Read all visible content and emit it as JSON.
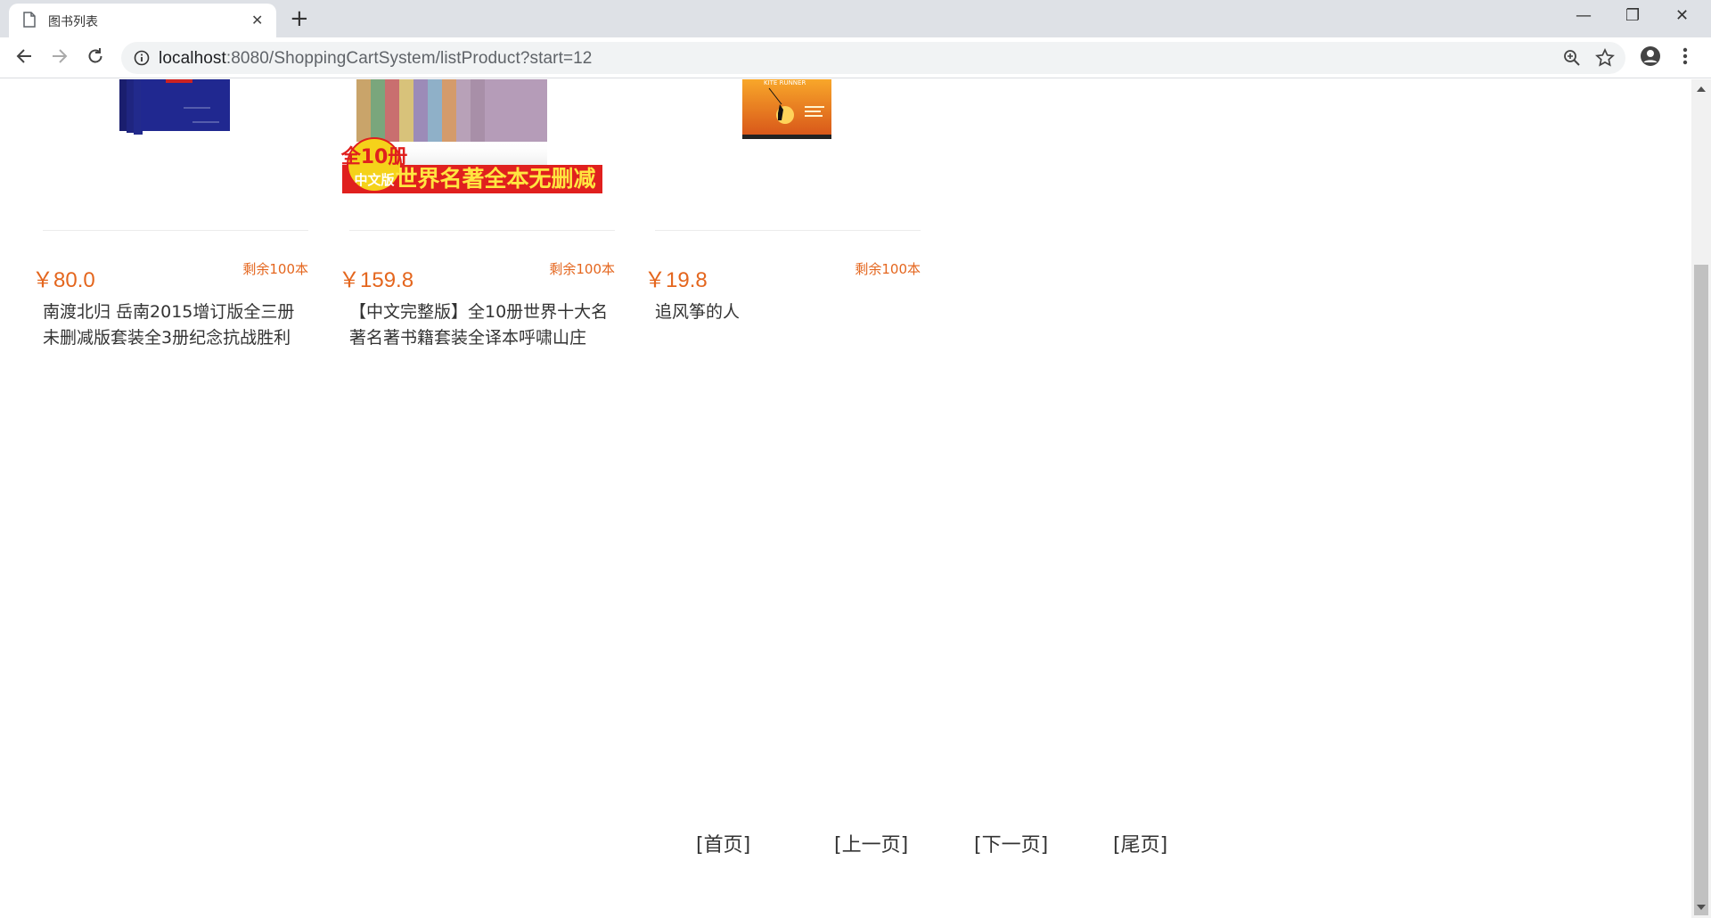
{
  "browser": {
    "tab_title": "图书列表",
    "new_tab_symbol": "+",
    "url_host": "localhost",
    "url_rest": ":8080/ShoppingCartSystem/listProduct?start=12",
    "window_controls": {
      "minimize": "—",
      "restore": "❐",
      "close": "✕"
    }
  },
  "products": [
    {
      "price": "￥80.0",
      "stock": "剩余100本",
      "name": "南渡北归 岳南2015增订版全三册未删减版套装全3册纪念抗战胜利",
      "image_icon": "book-set-blue-cover-image"
    },
    {
      "price": "￥159.8",
      "stock": "剩余100本",
      "name": "【中文完整版】全10册世界十大名著名著书籍套装全译本呼啸山庄",
      "image_icon": "world-classics-10-books-image",
      "image_banner_badge_top": "全10册",
      "image_banner_badge_bottom": "中文版",
      "image_banner_text": "世界名著全本无删减"
    },
    {
      "price": "￥19.8",
      "stock": "剩余100本",
      "name": "追风筝的人",
      "image_icon": "kite-runner-cover-image",
      "image_cover_text": "KITE RUNNER"
    }
  ],
  "pagination": {
    "first": "[首页]",
    "prev": "[上一页]",
    "next": "[下一页]",
    "last": "[尾页]"
  },
  "colors": {
    "accent": "#e4661e",
    "tabbar": "#dee1e6",
    "omnibox": "#f1f3f4"
  }
}
